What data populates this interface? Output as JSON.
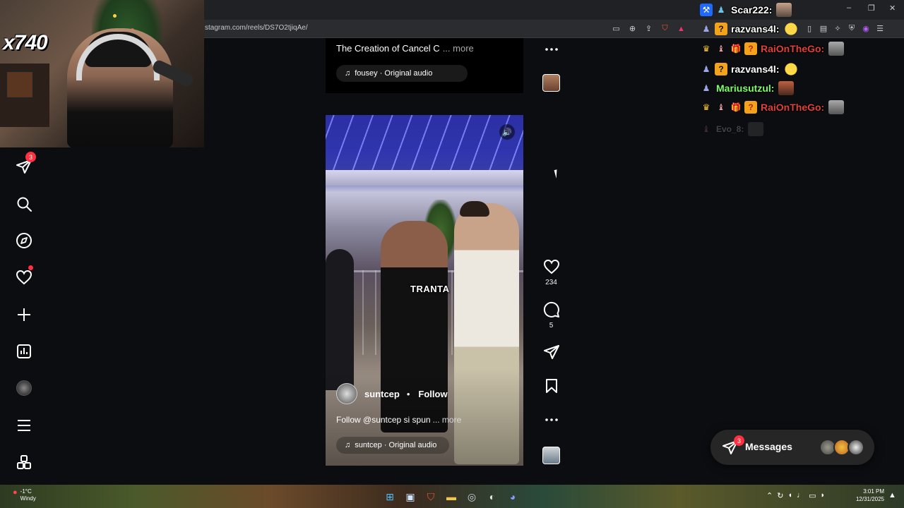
{
  "browser": {
    "url": "stagram.com/reels/DS7O2tjiqAe/"
  },
  "stream": {
    "viewer_count": "x740"
  },
  "sidebar": {
    "notifications_badge": "3"
  },
  "reel_top": {
    "caption": "The Creation of Cancel C",
    "more": "... more",
    "audio": "fousey · Original audio"
  },
  "reel": {
    "subtitle": "TRANTA",
    "author": "suntcep",
    "separator": "•",
    "follow_label": "Follow",
    "caption": "Follow @suntcep si spun",
    "more": "... more",
    "audio": "suntcep · Original audio",
    "likes": "234",
    "comments": "5"
  },
  "chat": {
    "messages": [
      {
        "name": "Scar222:",
        "color": "#ffffff"
      },
      {
        "name": "razvans4l:",
        "color": "#ffffff"
      },
      {
        "name": "RaiOnTheGo:",
        "color": "#e0403a"
      },
      {
        "name": "razvans4l:",
        "color": "#ffffff"
      },
      {
        "name": "Mariusutzul:",
        "color": "#7cff6a"
      },
      {
        "name": "RaiOnTheGo:",
        "color": "#e0403a"
      },
      {
        "name": "Evo_8:",
        "color": "#ffffff"
      }
    ]
  },
  "messages_panel": {
    "label": "Messages",
    "badge": "3"
  },
  "taskbar": {
    "weather_temp": "-1°C",
    "weather_desc": "Windy",
    "time": "3:01 PM",
    "date": "12/31/2025"
  },
  "icons": {
    "sidebar": [
      "direct-icon",
      "search-icon",
      "explore-icon",
      "heart-icon",
      "create-icon",
      "dashboard-icon",
      "profile-avatar",
      "menu-icon",
      "apps-icon"
    ],
    "actions": [
      "heart-icon",
      "comment-icon",
      "share-icon",
      "bookmark-icon",
      "more-icon"
    ]
  },
  "colors": {
    "badge": "#ff3040",
    "background": "#0b0d10",
    "panel": "#262626"
  }
}
